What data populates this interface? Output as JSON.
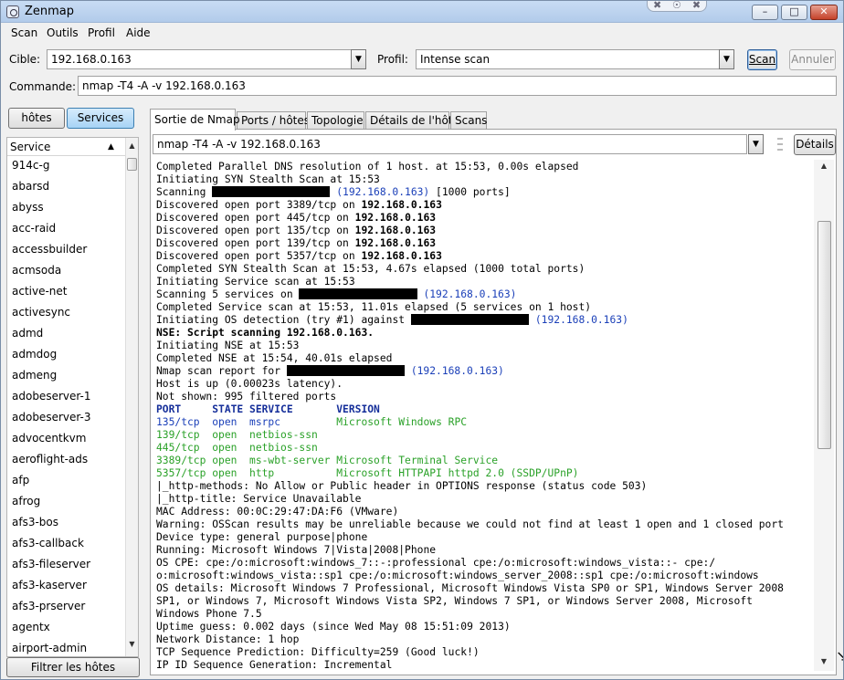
{
  "window": {
    "title": "Zenmap",
    "tray_icons": [
      "✖",
      "☉",
      "✖"
    ],
    "controls": {
      "minimize": "–",
      "maximize": "□",
      "close": "✕"
    }
  },
  "menu": [
    "Scan",
    "Outils",
    "Profil",
    "Aide"
  ],
  "target": {
    "label": "Cible:",
    "value": "192.168.0.163"
  },
  "profile": {
    "label": "Profil:",
    "value": "Intense scan"
  },
  "buttons": {
    "scan": "Scan",
    "cancel": "Annuler",
    "details": "Détails",
    "filter": "Filtrer les hôtes",
    "hosts": "hôtes",
    "services": "Services"
  },
  "command": {
    "label": "Commande:",
    "value": "nmap -T4 -A -v 192.168.0.163"
  },
  "left_panel": {
    "header": "Service",
    "services": [
      "914c-g",
      "abarsd",
      "abyss",
      "acc-raid",
      "accessbuilder",
      "acmsoda",
      "active-net",
      "activesync",
      "admd",
      "admdog",
      "admeng",
      "adobeserver-1",
      "adobeserver-3",
      "advocentkvm",
      "aeroflight-ads",
      "afp",
      "afrog",
      "afs3-bos",
      "afs3-callback",
      "afs3-fileserver",
      "afs3-kaserver",
      "afs3-prserver",
      "agentx",
      "airport-admin"
    ]
  },
  "tabs": [
    "Sortie de Nmap",
    "Ports / hôtes",
    "Topologie",
    "Détails de l'hôte",
    "Scans"
  ],
  "output_select": "nmap -T4 -A -v 192.168.0.163",
  "output": [
    {
      "t": "Completed Parallel DNS resolution of 1 host. at 15:53, 0.00s elapsed"
    },
    {
      "t": "Initiating SYN Stealth Scan at 15:53"
    },
    {
      "pre": "Scanning ",
      "redact": 19,
      "ip": "(192.168.0.163)",
      "post": " [1000 ports]"
    },
    {
      "pre": "Discovered open port 3389/tcp on ",
      "b": "192.168.0.163"
    },
    {
      "pre": "Discovered open port 445/tcp on ",
      "b": "192.168.0.163"
    },
    {
      "pre": "Discovered open port 135/tcp on ",
      "b": "192.168.0.163"
    },
    {
      "pre": "Discovered open port 139/tcp on ",
      "b": "192.168.0.163"
    },
    {
      "pre": "Discovered open port 5357/tcp on ",
      "b": "192.168.0.163"
    },
    {
      "t": "Completed SYN Stealth Scan at 15:53, 4.67s elapsed (1000 total ports)"
    },
    {
      "t": "Initiating Service scan at 15:53"
    },
    {
      "pre": "Scanning 5 services on ",
      "redact": 19,
      "ip": "(192.168.0.163)"
    },
    {
      "t": "Completed Service scan at 15:53, 11.01s elapsed (5 services on 1 host)"
    },
    {
      "pre": "Initiating OS detection (try #1) against ",
      "redact": 19,
      "ip": "(192.168.0.163)"
    },
    {
      "b": "NSE: Script scanning 192.168.0.163."
    },
    {
      "t": "Initiating NSE at 15:53"
    },
    {
      "t": "Completed NSE at 15:54, 40.01s elapsed"
    },
    {
      "pre": "Nmap scan report for ",
      "redact": 19,
      "ip": "(192.168.0.163)"
    },
    {
      "t": "Host is up (0.00023s latency)."
    },
    {
      "t": "Not shown: 995 filtered ports"
    },
    {
      "navy": "PORT     STATE SERVICE       VERSION"
    },
    {
      "port": "135/tcp  open  msrpc         ",
      "green": "Microsoft Windows RPC"
    },
    {
      "green": "139/tcp  open  netbios-ssn"
    },
    {
      "green": "445/tcp  open  netbios-ssn"
    },
    {
      "green": "3389/tcp open  ms-wbt-server Microsoft Terminal Service"
    },
    {
      "green": "5357/tcp open  http          Microsoft HTTPAPI httpd 2.0 (SSDP/UPnP)"
    },
    {
      "t": "|_http-methods: No Allow or Public header in OPTIONS response (status code 503)"
    },
    {
      "t": "|_http-title: Service Unavailable"
    },
    {
      "t": "MAC Address: 00:0C:29:47:DA:F6 (VMware)"
    },
    {
      "t": "Warning: OSScan results may be unreliable because we could not find at least 1 open and 1 closed port"
    },
    {
      "t": "Device type: general purpose|phone"
    },
    {
      "t": "Running: Microsoft Windows 7|Vista|2008|Phone"
    },
    {
      "t": "OS CPE: cpe:/o:microsoft:windows_7::-:professional cpe:/o:microsoft:windows_vista::- cpe:/"
    },
    {
      "t": "o:microsoft:windows_vista::sp1 cpe:/o:microsoft:windows_server_2008::sp1 cpe:/o:microsoft:windows"
    },
    {
      "t": "OS details: Microsoft Windows 7 Professional, Microsoft Windows Vista SP0 or SP1, Windows Server 2008"
    },
    {
      "t": "SP1, or Windows 7, Microsoft Windows Vista SP2, Windows 7 SP1, or Windows Server 2008, Microsoft"
    },
    {
      "t": "Windows Phone 7.5"
    },
    {
      "t": "Uptime guess: 0.002 days (since Wed May 08 15:51:09 2013)"
    },
    {
      "t": "Network Distance: 1 hop"
    },
    {
      "t": "TCP Sequence Prediction: Difficulty=259 (Good luck!)"
    },
    {
      "t": "IP ID Sequence Generation: Incremental"
    }
  ]
}
